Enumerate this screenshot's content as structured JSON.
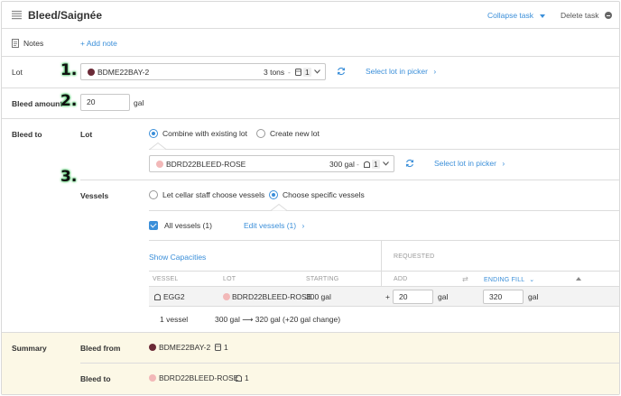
{
  "header": {
    "title": "Bleed/Saignée",
    "collapse_label": "Collapse task",
    "delete_label": "Delete task"
  },
  "notes": {
    "label": "Notes",
    "add_label": "+ Add note"
  },
  "lot": {
    "label": "Lot",
    "selected": "BDME22BAY-2",
    "amount": "3 tons",
    "vessel_count": "1",
    "picker_label": "Select lot in picker",
    "color": "#6b2a37"
  },
  "bleed_amount": {
    "label": "Bleed amount",
    "value": "20",
    "unit": "gal"
  },
  "bleed_to": {
    "label": "Bleed to",
    "lot_label": "Lot",
    "option_combine": "Combine with existing lot",
    "option_create": "Create new lot",
    "selected_lot": "BDRD22BLEED-ROSE",
    "selected_amount": "300 gal",
    "selected_vessel_count": "1",
    "picker_label": "Select lot in picker",
    "lot_color": "#f2b8b8",
    "vessels_label": "Vessels",
    "option_cellar": "Let cellar staff choose vessels",
    "option_specific": "Choose specific vessels",
    "all_vessels_label": "All vessels (1)",
    "edit_vessels_label": "Edit vessels (1)",
    "show_capacities": "Show Capacities",
    "requested_header": "REQUESTED",
    "columns": {
      "vessel": "VESSEL",
      "lot": "LOT",
      "starting": "STARTING",
      "add": "ADD",
      "ending_fill": "ENDING FILL"
    },
    "row": {
      "vessel": "EGG2",
      "lot": "BDRD22BLEED-ROSE",
      "starting": "300 gal",
      "add_sign": "+",
      "add_value": "20",
      "add_unit": "gal",
      "ending_value": "320",
      "ending_unit": "gal"
    },
    "footer_count": "1 vessel",
    "footer_change": "300 gal  ⟶  320 gal (+20 gal change)"
  },
  "summary": {
    "label": "Summary",
    "from_label": "Bleed from",
    "from_lot": "BDME22BAY-2",
    "from_count": "1",
    "to_label": "Bleed to",
    "to_lot": "BDRD22BLEED-ROSE",
    "to_count": "1"
  },
  "markers": {
    "one": "1.",
    "two": "2.",
    "three": "3."
  }
}
